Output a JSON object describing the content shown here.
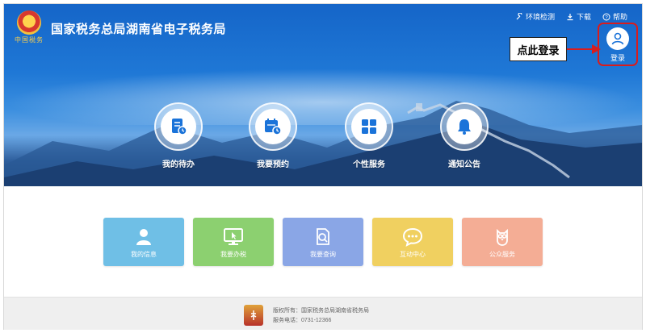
{
  "header": {
    "site_title": "国家税务总局湖南省电子税务局",
    "logo_caption": "中国税务",
    "top_links": [
      {
        "label": "环境检测",
        "icon": "wrench-icon"
      },
      {
        "label": "下载",
        "icon": "download-icon"
      },
      {
        "label": "帮助",
        "icon": "help-icon"
      }
    ],
    "login_label": "登录"
  },
  "annotation": {
    "callout_text": "点此登录",
    "highlight_color": "#d91c1c"
  },
  "quick_actions": [
    {
      "label": "我的待办",
      "icon": "todo-document-icon"
    },
    {
      "label": "我要预约",
      "icon": "calendar-clock-icon"
    },
    {
      "label": "个性服务",
      "icon": "grid-icon"
    },
    {
      "label": "通知公告",
      "icon": "bell-icon"
    }
  ],
  "tiles": [
    {
      "label": "我的信息",
      "icon": "user-icon",
      "color": "#6fbfe6"
    },
    {
      "label": "我要办税",
      "icon": "monitor-icon",
      "color": "#8cd070"
    },
    {
      "label": "我要查询",
      "icon": "search-document-icon",
      "color": "#8aa6e6"
    },
    {
      "label": "互动中心",
      "icon": "chat-icon",
      "color": "#f0d060"
    },
    {
      "label": "公众服务",
      "icon": "owl-icon",
      "color": "#f4ad95"
    }
  ],
  "footer": {
    "copyright": "版权所有：国家税务总局湖南省税务局",
    "phone": "服务电话：0731-12366"
  },
  "colors": {
    "hero_blue": "#1565c8",
    "accent_blue": "#1a73d9"
  }
}
